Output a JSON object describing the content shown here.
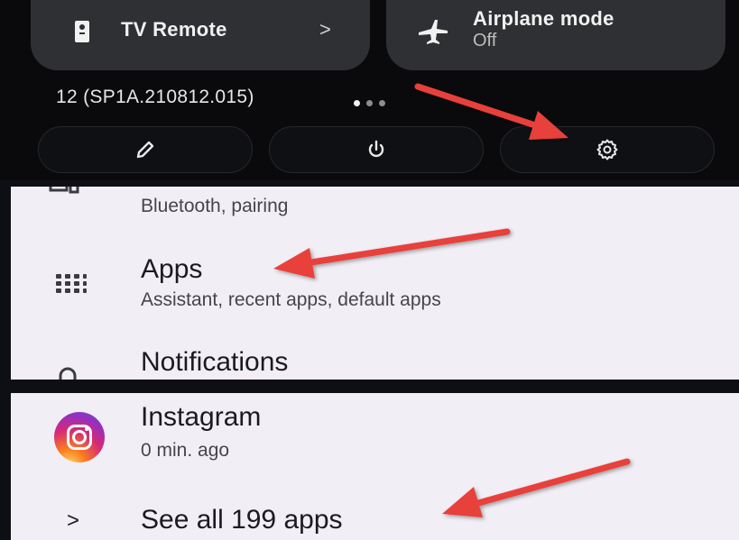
{
  "quick_settings": {
    "tile_tv": {
      "label": "TV Remote",
      "chevron": ">"
    },
    "tile_airplane": {
      "label": "Airplane mode",
      "state": "Off"
    },
    "build_number": "12 (SP1A.210812.015)"
  },
  "settings_list": {
    "items": [
      {
        "title": "",
        "subtitle": "Bluetooth, pairing",
        "icon": "devices-icon"
      },
      {
        "title": "Apps",
        "subtitle": "Assistant, recent apps, default apps",
        "icon": "apps-grid-icon"
      },
      {
        "title": "Notifications",
        "subtitle": "",
        "icon": "bell-icon"
      }
    ]
  },
  "recent_apps": {
    "items": [
      {
        "name": "Instagram",
        "time": "0 min. ago",
        "icon": "instagram-icon"
      }
    ],
    "see_all_chevron": ">",
    "see_all_label": "See all 199 apps"
  },
  "colors": {
    "panel_bg": "#0a0a0c",
    "tile_bg": "#2f3033",
    "card_bg": "#f2eef6",
    "arrow": "#e8403a"
  }
}
